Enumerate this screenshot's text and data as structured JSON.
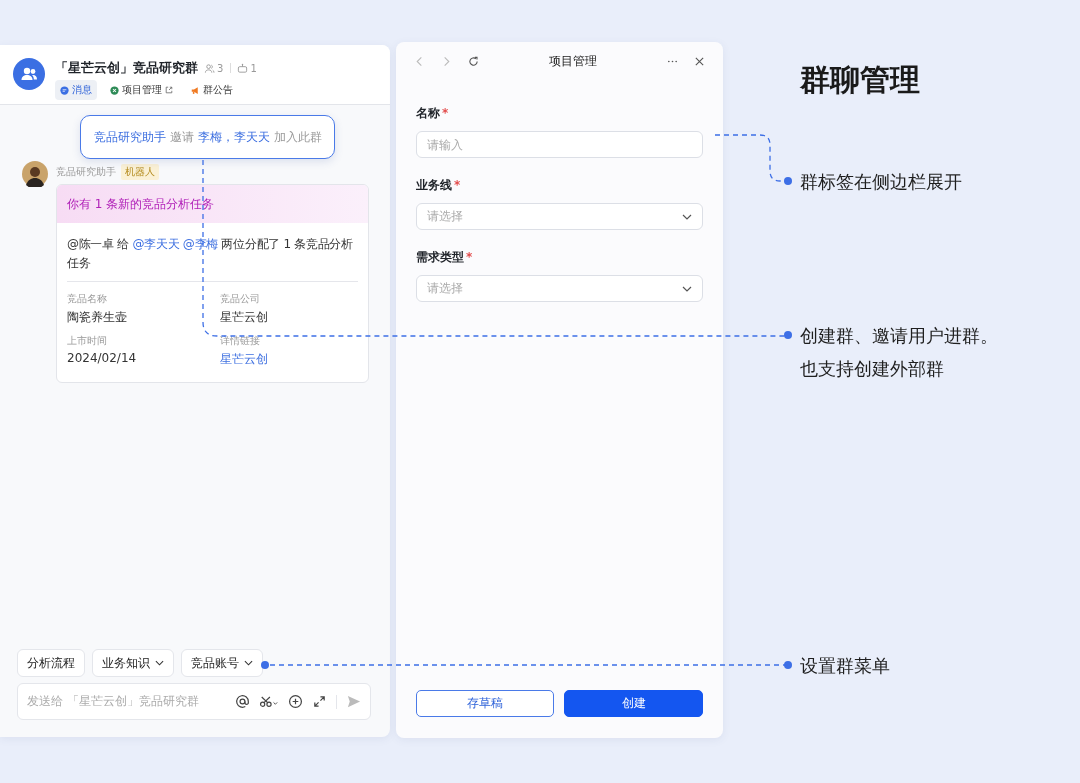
{
  "chat": {
    "title": "「星芒云创」竞品研究群",
    "member_count": "3",
    "bot_count": "1",
    "tabs": [
      {
        "label": "消息",
        "external": false,
        "selected": true
      },
      {
        "label": "项目管理",
        "external": true,
        "selected": false
      },
      {
        "label": "群公告",
        "external": false,
        "selected": false
      }
    ],
    "notice": [
      {
        "text": "竞品研究助手",
        "kind": "name"
      },
      {
        "text": "邀请",
        "kind": "plain"
      },
      {
        "text": "李梅，李天天",
        "kind": "name"
      },
      {
        "text": "加入此群",
        "kind": "plain"
      }
    ],
    "message": {
      "sender": "竞品研究助手",
      "badge": "机器人",
      "card_title": "你有 1 条新的竞品分析任务",
      "body": [
        {
          "text": "@陈一卓 给 ",
          "kind": "plain"
        },
        {
          "text": "@李天天 @李梅",
          "kind": "mention"
        },
        {
          "text": " 两位分配了 1 条竞品分析任务",
          "kind": "plain"
        }
      ],
      "fields": [
        {
          "label": "竞品名称",
          "value": "陶瓷养生壶",
          "kind": "text"
        },
        {
          "label": "竞品公司",
          "value": "星芒云创",
          "kind": "text"
        },
        {
          "label": "上市时间",
          "value": "2024/02/14",
          "kind": "text"
        },
        {
          "label": "详情链接",
          "value": "星芒云创",
          "kind": "link"
        }
      ]
    },
    "quick_menus": [
      {
        "label": "分析流程",
        "dropdown": false
      },
      {
        "label": "业务知识",
        "dropdown": true
      },
      {
        "label": "竞品账号",
        "dropdown": true
      }
    ],
    "composer": {
      "placeholder": "发送给 「星芒云创」竞品研究群"
    }
  },
  "form_panel": {
    "title": "项目管理",
    "fields": [
      {
        "label": "名称",
        "required_mark": "*",
        "kind": "input",
        "placeholder": "请输入"
      },
      {
        "label": "业务线",
        "required_mark": "*",
        "kind": "select",
        "placeholder": "请选择"
      },
      {
        "label": "需求类型",
        "required_mark": "*",
        "kind": "select",
        "placeholder": "请选择"
      }
    ],
    "buttons": [
      {
        "label": "存草稿",
        "kind": "secondary"
      },
      {
        "label": "创建",
        "kind": "primary"
      }
    ]
  },
  "annotation_title": "群聊管理",
  "annotations": [
    {
      "lines": [
        "群标签在侧边栏展开"
      ]
    },
    {
      "lines": [
        "创建群、邀请用户进群。",
        "也支持创建外部群"
      ]
    },
    {
      "lines": [
        "设置群菜单"
      ]
    }
  ]
}
